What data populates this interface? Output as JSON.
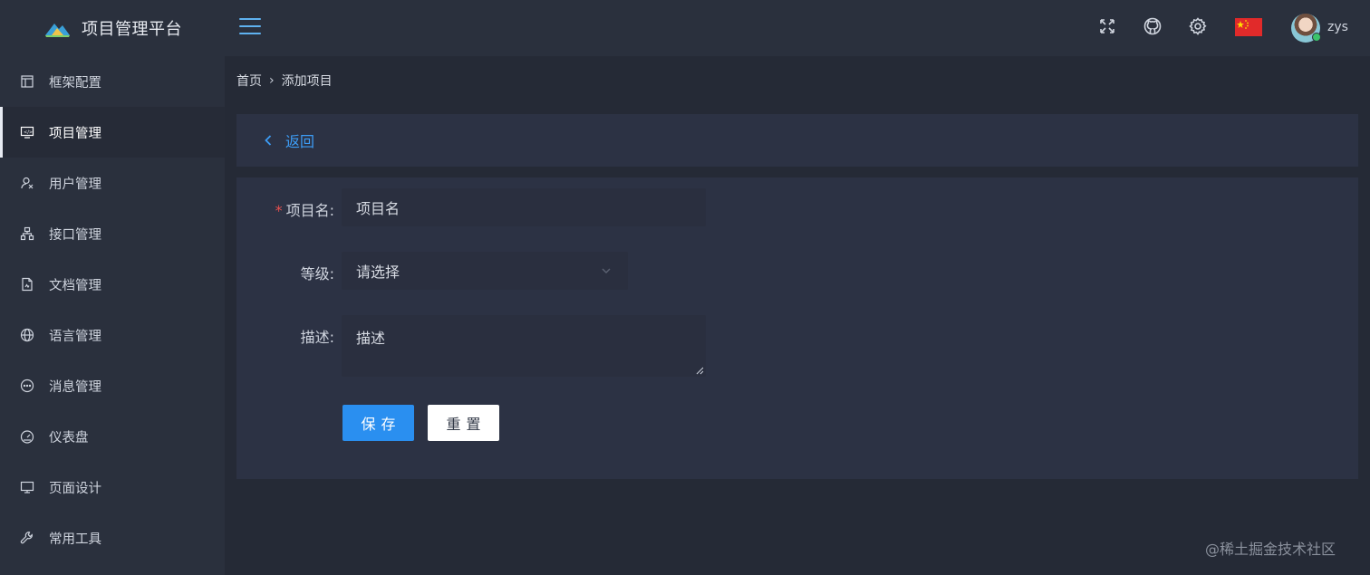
{
  "app": {
    "title": "项目管理平台"
  },
  "sidebar": {
    "items": [
      {
        "label": "框架配置",
        "icon": "layout-icon"
      },
      {
        "label": "项目管理",
        "icon": "monitor-code-icon",
        "active": true
      },
      {
        "label": "用户管理",
        "icon": "user-icon"
      },
      {
        "label": "接口管理",
        "icon": "sitemap-icon"
      },
      {
        "label": "文档管理",
        "icon": "document-icon"
      },
      {
        "label": "语言管理",
        "icon": "globe-icon"
      },
      {
        "label": "消息管理",
        "icon": "chat-icon"
      },
      {
        "label": "仪表盘",
        "icon": "gauge-icon"
      },
      {
        "label": "页面设计",
        "icon": "desktop-icon"
      },
      {
        "label": "常用工具",
        "icon": "wrench-icon"
      }
    ]
  },
  "header": {
    "icons": [
      "fullscreen-icon",
      "github-icon",
      "settings-icon",
      "china-flag-icon"
    ],
    "username": "zys"
  },
  "breadcrumb": {
    "home": "首页",
    "separator": "›",
    "current": "添加项目"
  },
  "back": {
    "label": "返回"
  },
  "form": {
    "name": {
      "label": "项目名:",
      "placeholder": "项目名",
      "required_mark": "*"
    },
    "level": {
      "label": "等级:",
      "placeholder": "请选择"
    },
    "description": {
      "label": "描述:",
      "placeholder": "描述"
    },
    "save_label": "保存",
    "reset_label": "重置"
  },
  "watermark": "@稀土掘金技术社区",
  "colors": {
    "accent": "#2a8ff0",
    "sidebar_bg": "#2a303d",
    "page_bg": "#252a36",
    "panel_bg": "#2c3244",
    "required": "#e8504f"
  }
}
